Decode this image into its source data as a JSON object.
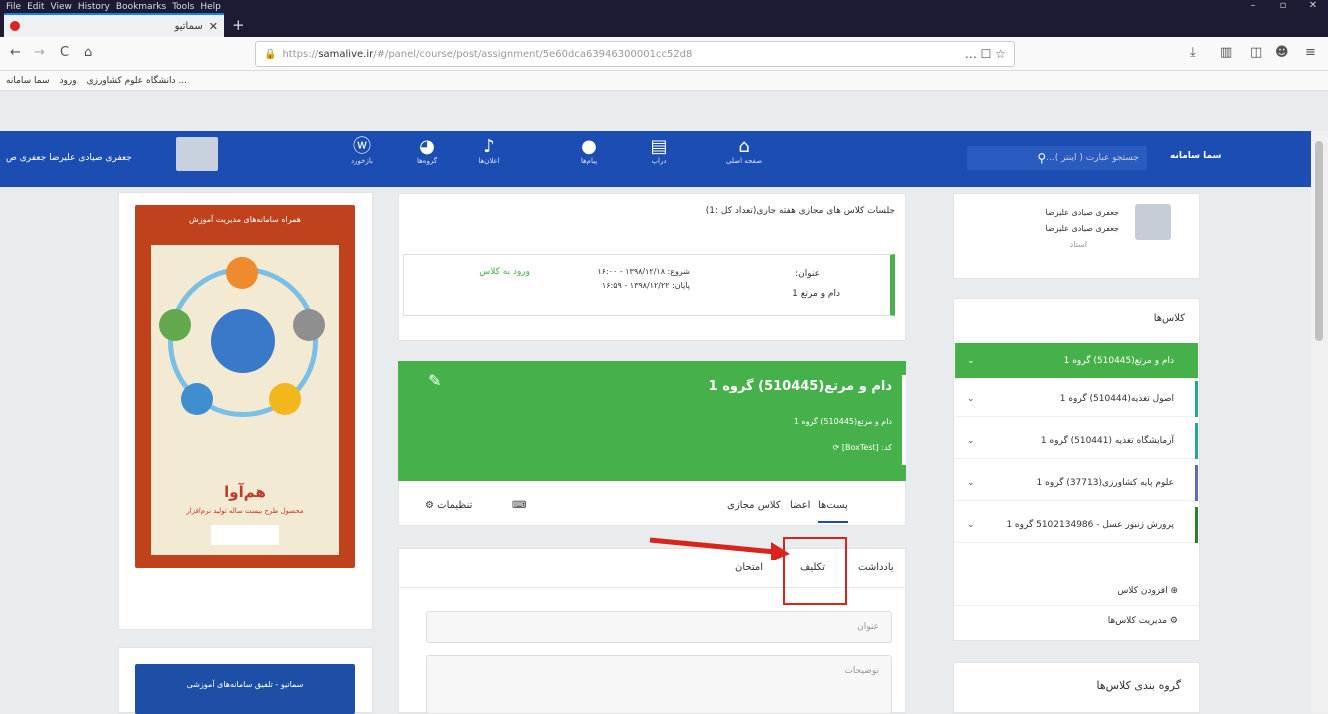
{
  "browser": {
    "menu": [
      "File",
      "Edit",
      "View",
      "History",
      "Bookmarks",
      "Tools",
      "Help"
    ],
    "window_controls": [
      "–",
      "▫",
      "✕"
    ],
    "tab_title": "سماتیو",
    "tab_close": "✕",
    "new_tab": "+",
    "back": "←",
    "forward": "→",
    "reload": "C",
    "home": "⌂",
    "url_prefix": "https://",
    "url_host": "samalive.ir",
    "url_path": "/#/panel/course/post/assignment/5e60dca63946300001cc52d8",
    "url_more": "… ☐ ☆",
    "toolbar_right": [
      "⤓",
      "▥",
      "◫",
      "☻",
      "≡"
    ],
    "bookmarks": [
      "سما سامانه",
      "ورود",
      "دانشگاه علوم کشاورزی ..."
    ]
  },
  "app": {
    "user_name": "جعفری صیادی علیرضا جعفری ص",
    "nav": [
      {
        "icon": "ⓦ",
        "label": "بازخورد"
      },
      {
        "icon": "◕",
        "label": "گروه‌ها"
      },
      {
        "icon": "♪",
        "label": "اعلان‌ها"
      },
      {
        "icon": "●",
        "label": "پیام‌ها"
      },
      {
        "icon": "▤",
        "label": "دراپ"
      },
      {
        "icon": "⌂",
        "label": "صفحه اصلی"
      }
    ],
    "search_placeholder": "جستجو عبارت ( اینتر )...",
    "brand": "سما سامانه"
  },
  "ads": {
    "top": {
      "banner": "همراه سامانه‌های مدیریت آموزش",
      "title": "هم‌آوا",
      "subtitle": "محصول طرح بیست ساله تولید نرم‌افزار"
    },
    "bottom": {
      "banner": "سماتیو - تلفیق سامانه‌های آموزشی"
    }
  },
  "sessions": {
    "header": "جلسات کلاس های مجازی هفته جاری(تعداد کل :1)",
    "title_label": "عنوان:",
    "title_value": "دام و مرتع 1",
    "start": "شروع: ۱۳۹۸/۱۲/۱۸ - ۱۶:۰۰",
    "end": "پایان: ۱۳۹۸/۱۲/۲۲ - ۱۶:۵۹",
    "join": "ورود به کلاس"
  },
  "course": {
    "name": "دام و مرتع(510445) گروه 1",
    "sub": "دام و مرتع(510445) گروه 1",
    "code": "کد: [BoxTest] ⟳",
    "edit": "✎"
  },
  "course_tabs": [
    "پست‌ها",
    "اعضا",
    "کلاس مجازی",
    "⌨",
    "⚙ تنظیمات"
  ],
  "post_tabs": [
    "یادداشت",
    "تکلیف",
    "امتحان"
  ],
  "form": {
    "title_placeholder": "عنوان",
    "desc_placeholder": "توضیحات"
  },
  "profile": {
    "name1": "جعفری صیادی علیرضا",
    "name2": "جعفری صیادی علیرضا",
    "role": "استاد"
  },
  "classes": {
    "header": "کلاس‌ها",
    "items": [
      {
        "name": "دام و مرتع(510445) گروه 1",
        "color": "#46b04a"
      },
      {
        "name": "اصول تغذیه(510444) گروه 1",
        "color": "#26a69a"
      },
      {
        "name": "آزمایشگاه تغذیه (510441) گروه 1",
        "color": "#26a69a"
      },
      {
        "name": "علوم پایه کشاورزی(37713) گروه 1",
        "color": "#5c6bc0"
      },
      {
        "name": "پرورش زنبور عسل - 5102134986 گروه 1",
        "color": "#2e7d32"
      }
    ],
    "add": "افزودن کلاس",
    "manage": "مدیریت کلاس‌ها"
  },
  "grouping": "گروه بندی کلاس‌ها",
  "colors": {
    "brand": "#1b4db2",
    "green": "#46b04a",
    "highlight": "#d9231d"
  }
}
